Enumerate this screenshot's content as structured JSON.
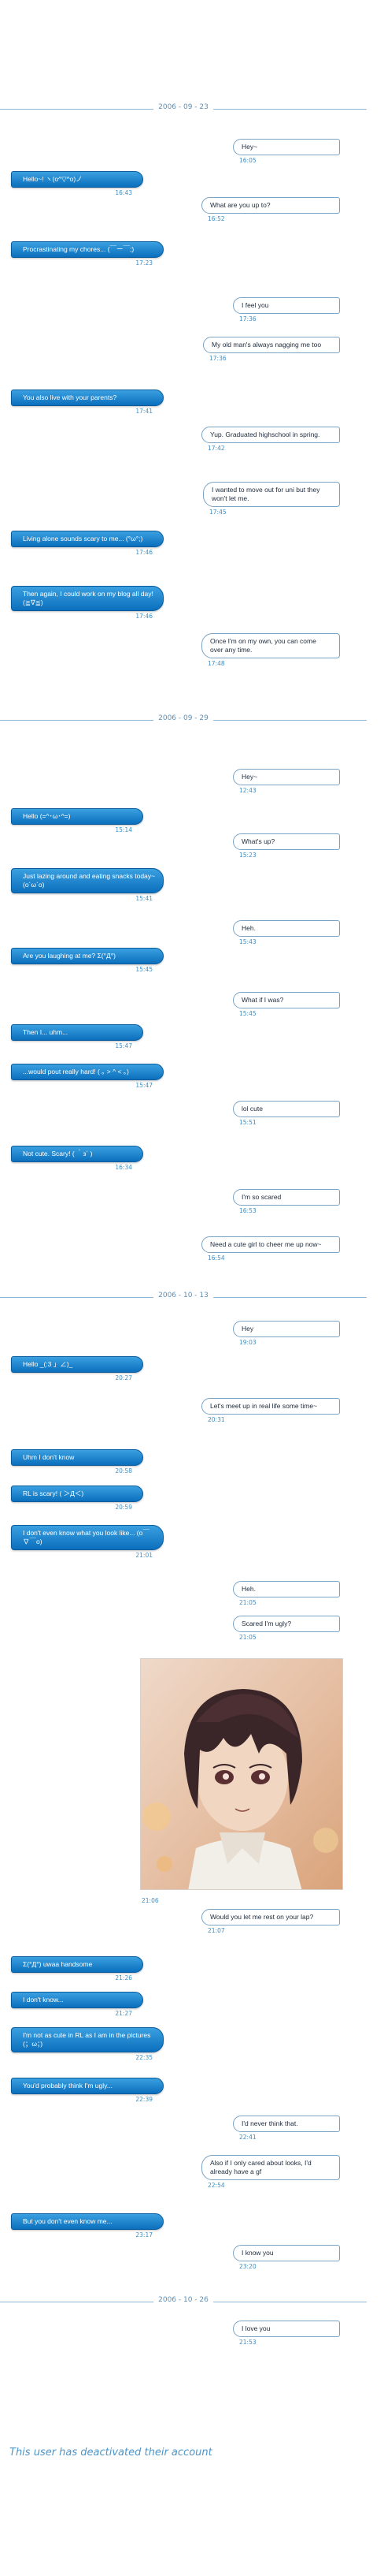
{
  "separators": [
    {
      "label": "2006 - 09 - 23"
    },
    {
      "label": "2006 - 09 - 29"
    },
    {
      "label": "2006 - 10 - 13"
    },
    {
      "label": "2006 - 10 - 26"
    }
  ],
  "messages": [
    {
      "side": "right",
      "text": "Hey~",
      "time": "16:05"
    },
    {
      "side": "left",
      "text": "Hello~! ヽ(o^▽^o)ノ",
      "time": "16:43"
    },
    {
      "side": "right",
      "text": "What are you up to?",
      "time": "16:52"
    },
    {
      "side": "left",
      "text": "Procrastinating my chores... (￣ー￣;)",
      "time": "17:23"
    },
    {
      "side": "right",
      "text": "I feel you",
      "time": "17:36"
    },
    {
      "side": "right",
      "text": "My old man's always nagging me too",
      "time": "17:36"
    },
    {
      "side": "left",
      "text": "You also live with your parents?",
      "time": "17:41"
    },
    {
      "side": "right",
      "text": "Yup. Graduated highschool in spring.",
      "time": "17:42"
    },
    {
      "side": "right",
      "text": "I wanted to move out for uni but they won't let me.",
      "time": "17:45"
    },
    {
      "side": "left",
      "text": "Living alone sounds scary to me... (°ω°;)",
      "time": "17:46"
    },
    {
      "side": "left",
      "text": "Then again, I could work on my blog all day! (≧∇≦)",
      "time": "17:46"
    },
    {
      "side": "right",
      "text": "Once I'm on my own, you can come over any time.",
      "time": "17:48"
    },
    {
      "side": "right",
      "text": "Hey~",
      "time": "12:43"
    },
    {
      "side": "left",
      "text": "Hello (=^･ω･^=)",
      "time": "15:14"
    },
    {
      "side": "right",
      "text": "What's up?",
      "time": "15:23"
    },
    {
      "side": "left",
      "text": "Just lazing around and eating snacks today~ (o´ω`o)",
      "time": "15:41"
    },
    {
      "side": "right",
      "text": "Heh.",
      "time": "15:43"
    },
    {
      "side": "left",
      "text": "Are you laughing at me? Σ(°Д°)",
      "time": "15:45"
    },
    {
      "side": "right",
      "text": "What if I was?",
      "time": "15:45"
    },
    {
      "side": "left",
      "text": "Then I... uhm...",
      "time": "15:47"
    },
    {
      "side": "left",
      "text": "...would pout really hard! ( ｡ > ^ < ｡)",
      "time": "15:47"
    },
    {
      "side": "right",
      "text": "lol cute",
      "time": "15:51"
    },
    {
      "side": "left",
      "text": "Not cute. Scary! ( ｀з´ )",
      "time": "16:34"
    },
    {
      "side": "right",
      "text": "I'm so scared",
      "time": "16:53"
    },
    {
      "side": "right",
      "text": "Need a cute girl to cheer me up now~",
      "time": "16:54"
    },
    {
      "side": "right",
      "text": "Hey",
      "time": "19:03"
    },
    {
      "side": "left",
      "text": "Hello _(:3 」∠)_",
      "time": "20:27"
    },
    {
      "side": "right",
      "text": "Let's meet up in real life some time~",
      "time": "20:31"
    },
    {
      "side": "left",
      "text": "Uhm I don't know",
      "time": "20:58"
    },
    {
      "side": "left",
      "text": "RL is scary! ( ＞Д＜)",
      "time": "20:59"
    },
    {
      "side": "left",
      "text": "I don't even know what you look like... (o￣∇￣o)",
      "time": "21:01"
    },
    {
      "side": "right",
      "text": "Heh.",
      "time": "21:05"
    },
    {
      "side": "right",
      "text": "Scared I'm ugly?",
      "time": "21:05"
    },
    {
      "side": "right",
      "text": "Would you let me rest on your lap?",
      "time": "21:07"
    },
    {
      "side": "left",
      "text": "Σ(°Д°) uwaa handsome",
      "time": "21:26"
    },
    {
      "side": "left",
      "text": "I don't know...",
      "time": "21:27"
    },
    {
      "side": "left",
      "text": "I'm not as cute in RL as I am in the pictures (；ω；)",
      "time": "22:35"
    },
    {
      "side": "left",
      "text": "You'd probably think I'm ugly...",
      "time": "22:39"
    },
    {
      "side": "right",
      "text": "I'd never think that.",
      "time": "22:41"
    },
    {
      "side": "right",
      "text": "Also if I only cared about looks, I'd already have a gf",
      "time": "22:54"
    },
    {
      "side": "left",
      "text": "But you don't even know me...",
      "time": "23:17"
    },
    {
      "side": "right",
      "text": "I know you",
      "time": "23:20"
    },
    {
      "side": "right",
      "text": "I love you",
      "time": "21:53"
    }
  ],
  "photo": {
    "time": "21:06"
  },
  "footer": {
    "text": "This user has deactivated their account"
  },
  "colors": {
    "accent": "#0b6fbd",
    "accent_light": "#3aa0e0",
    "timestamp": "#3d8ec4",
    "separator": "#8fb7d6"
  }
}
